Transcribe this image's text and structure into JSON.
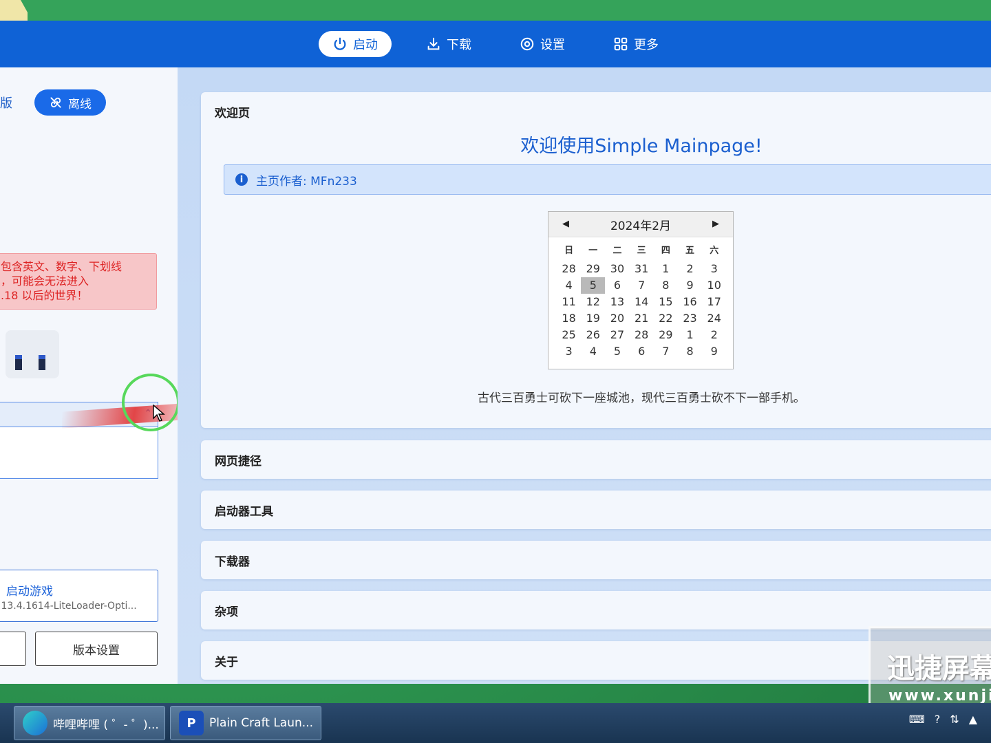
{
  "nav": {
    "launch": "启动",
    "download": "下载",
    "settings": "设置",
    "more": "更多"
  },
  "left": {
    "version_partial": "版",
    "offline": "离线",
    "warning": [
      "包含英文、数字、下划线",
      "，可能会无法进入",
      ".18 以后的世界！"
    ],
    "launch_title": "启动游戏",
    "launch_version": ".13.4.1614-LiteLoader-Opti...",
    "version_settings": "版本设置"
  },
  "welcome": {
    "card_title": "欢迎页",
    "heading": "欢迎使用Simple Mainpage!",
    "author": "主页作者: MFn233",
    "quote": "古代三百勇士可砍下一座城池，现代三百勇士砍不下一部手机。"
  },
  "calendar": {
    "month": "2024年2月",
    "weekdays": [
      "日",
      "一",
      "二",
      "三",
      "四",
      "五",
      "六"
    ],
    "days": [
      "28",
      "29",
      "30",
      "31",
      "1",
      "2",
      "3",
      "4",
      "5",
      "6",
      "7",
      "8",
      "9",
      "10",
      "11",
      "12",
      "13",
      "14",
      "15",
      "16",
      "17",
      "18",
      "19",
      "20",
      "21",
      "22",
      "23",
      "24",
      "25",
      "26",
      "27",
      "28",
      "29",
      "1",
      "2",
      "3",
      "4",
      "5",
      "6",
      "7",
      "8",
      "9"
    ],
    "today_index": 8
  },
  "sections": [
    "网页捷径",
    "启动器工具",
    "下载器",
    "杂项",
    "关于"
  ],
  "watermark": {
    "big": "迅捷屏幕",
    "small": "www.xunji"
  },
  "taskbar": {
    "task1": "哔哩哔哩 ( ゜- ゜)...",
    "task2": "Plain Craft Laun...",
    "task2_icon": "P"
  },
  "colors": {
    "accent": "#0f62d6",
    "warning": "#d22222"
  }
}
